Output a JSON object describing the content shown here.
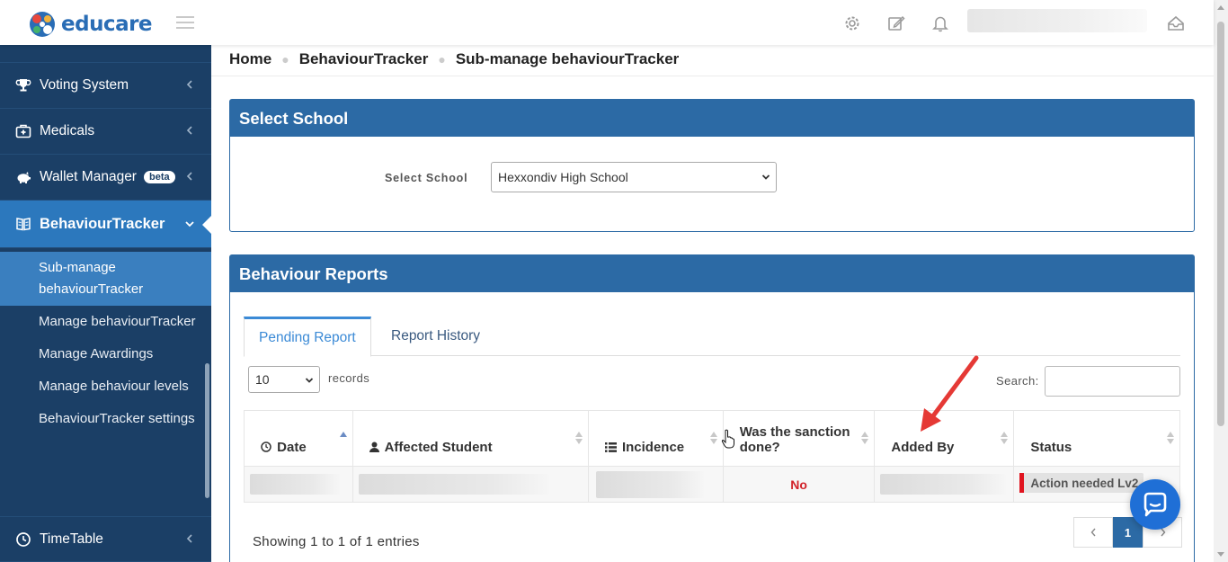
{
  "app": {
    "name": "educare"
  },
  "sidebar": {
    "items": [
      {
        "label": "Voting System",
        "icon": "trophy-icon"
      },
      {
        "label": "Medicals",
        "icon": "first-aid-kit-icon"
      },
      {
        "label": "Wallet Manager",
        "icon": "piggy-bank-icon",
        "badge": "beta"
      },
      {
        "label": "BehaviourTracker",
        "icon": "book-icon",
        "active": true
      }
    ],
    "subitems": [
      {
        "label": "Sub-manage behaviourTracker",
        "active": true
      },
      {
        "label": "Manage behaviourTracker"
      },
      {
        "label": "Manage Awardings"
      },
      {
        "label": "Manage behaviour levels"
      },
      {
        "label": "BehaviourTracker settings"
      }
    ],
    "bottom_item": {
      "label": "TimeTable",
      "icon": "clock-icon"
    }
  },
  "breadcrumb": [
    "Home",
    "BehaviourTracker",
    "Sub-manage behaviourTracker"
  ],
  "select_school_panel": {
    "title": "Select School",
    "label": "Select School",
    "selected": "Hexxondiv High School"
  },
  "reports_panel": {
    "title": "Behaviour Reports",
    "tabs": [
      "Pending Report",
      "Report History"
    ],
    "length_value": "10",
    "records_label": "records",
    "search_label": "Search:",
    "columns": [
      "Date",
      "Affected Student",
      "Incidence",
      "Was the sanction done?",
      "Added By",
      "Status"
    ],
    "rows": [
      {
        "sanction_done": "No",
        "status": "Action needed Lv2"
      }
    ],
    "info": "Showing 1 to 1 of 1 entries",
    "pagination": {
      "current": "1"
    }
  },
  "colors": {
    "sidebar_bg": "#1b3f66",
    "sidebar_active": "#2c78bd",
    "panel_header": "#2c6aa5",
    "tab_active": "#3b8ad6",
    "danger": "#e0141f",
    "chat": "#1f6fd6"
  }
}
